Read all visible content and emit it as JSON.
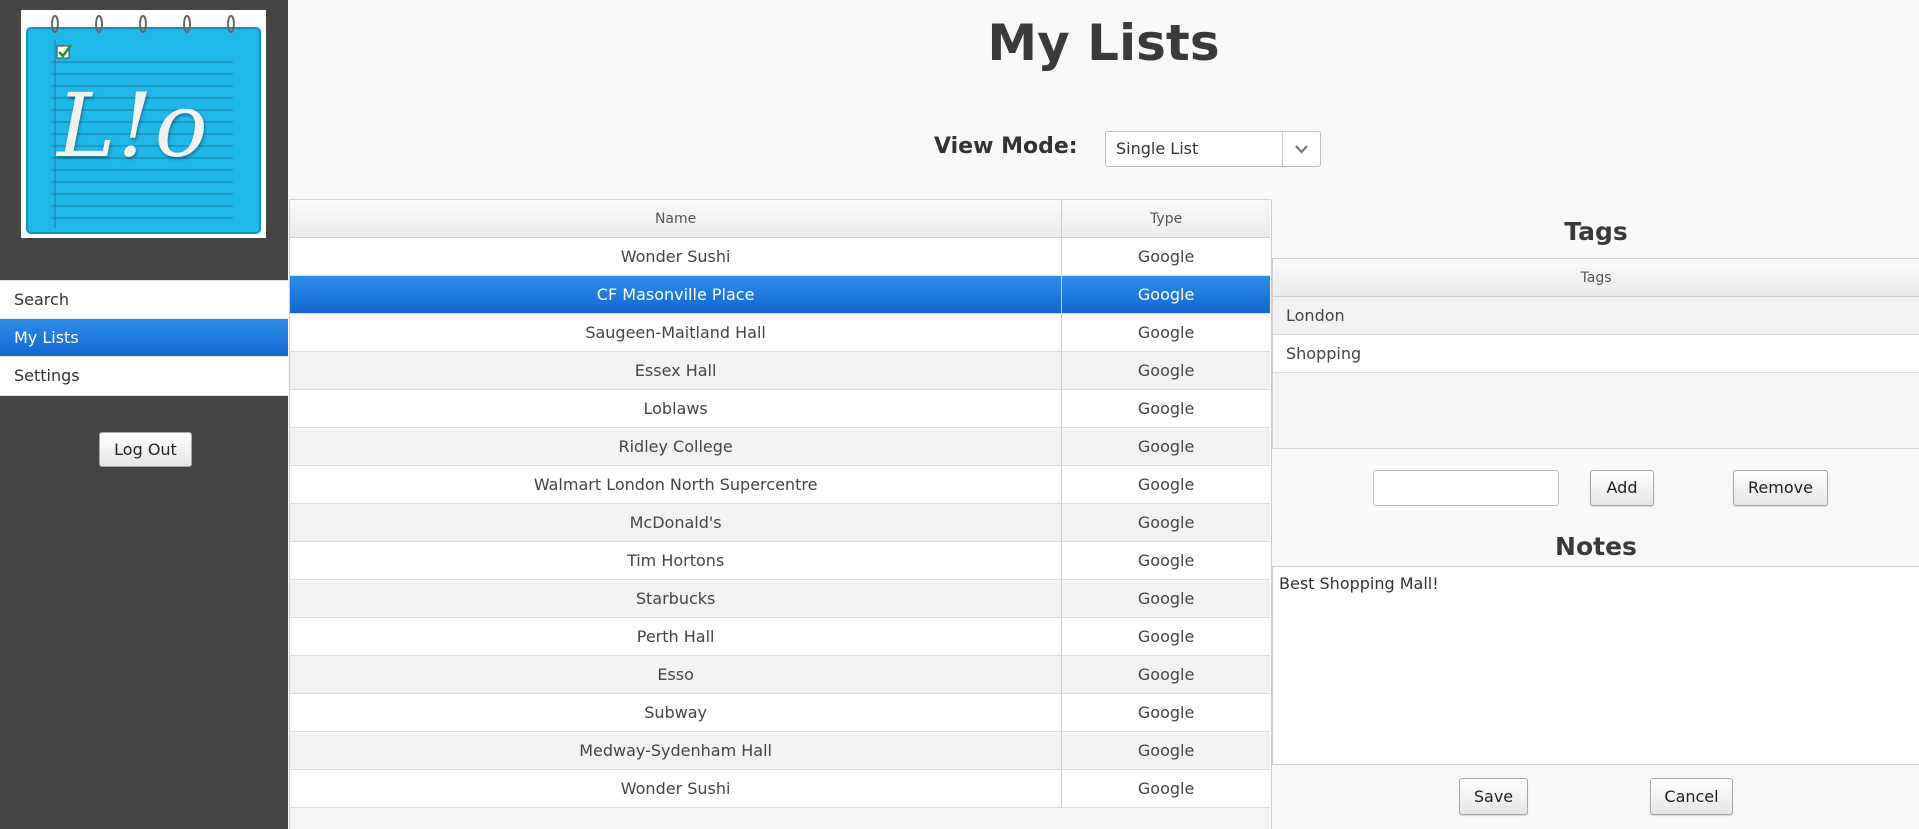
{
  "app": {
    "logo_text": "L!o"
  },
  "nav": {
    "items": [
      {
        "label": "Search",
        "active": false
      },
      {
        "label": "My Lists",
        "active": true
      },
      {
        "label": "Settings",
        "active": false
      }
    ],
    "logout_label": "Log Out"
  },
  "header": {
    "title": "My Lists",
    "view_mode_label": "View Mode:",
    "view_mode_value": "Single List"
  },
  "table": {
    "columns": [
      "Name",
      "Type"
    ],
    "selected_index": 1,
    "rows": [
      {
        "name": "Wonder Sushi",
        "type": "Google"
      },
      {
        "name": "CF Masonville Place",
        "type": "Google"
      },
      {
        "name": "Saugeen-Maitland Hall",
        "type": "Google"
      },
      {
        "name": "Essex Hall",
        "type": "Google"
      },
      {
        "name": "Loblaws",
        "type": "Google"
      },
      {
        "name": "Ridley College",
        "type": "Google"
      },
      {
        "name": "Walmart London North Supercentre",
        "type": "Google"
      },
      {
        "name": "McDonald's",
        "type": "Google"
      },
      {
        "name": "Tim Hortons",
        "type": "Google"
      },
      {
        "name": "Starbucks",
        "type": "Google"
      },
      {
        "name": "Perth Hall",
        "type": "Google"
      },
      {
        "name": "Esso",
        "type": "Google"
      },
      {
        "name": "Subway",
        "type": "Google"
      },
      {
        "name": "Medway-Sydenham Hall",
        "type": "Google"
      },
      {
        "name": "Wonder Sushi",
        "type": "Google"
      }
    ]
  },
  "tags": {
    "title": "Tags",
    "column": "Tags",
    "items": [
      "London",
      "Shopping"
    ],
    "input_value": "",
    "add_label": "Add",
    "remove_label": "Remove"
  },
  "notes": {
    "title": "Notes",
    "text": "Best Shopping Mall!",
    "save_label": "Save",
    "cancel_label": "Cancel"
  },
  "colors": {
    "sidebar_bg": "#444444",
    "selection": "#1a73dc",
    "logo_bg": "#1fb8e8"
  },
  "icons": {
    "view_mode_arrow": "chevron-down-icon",
    "logo_check": "checkmark-icon"
  }
}
